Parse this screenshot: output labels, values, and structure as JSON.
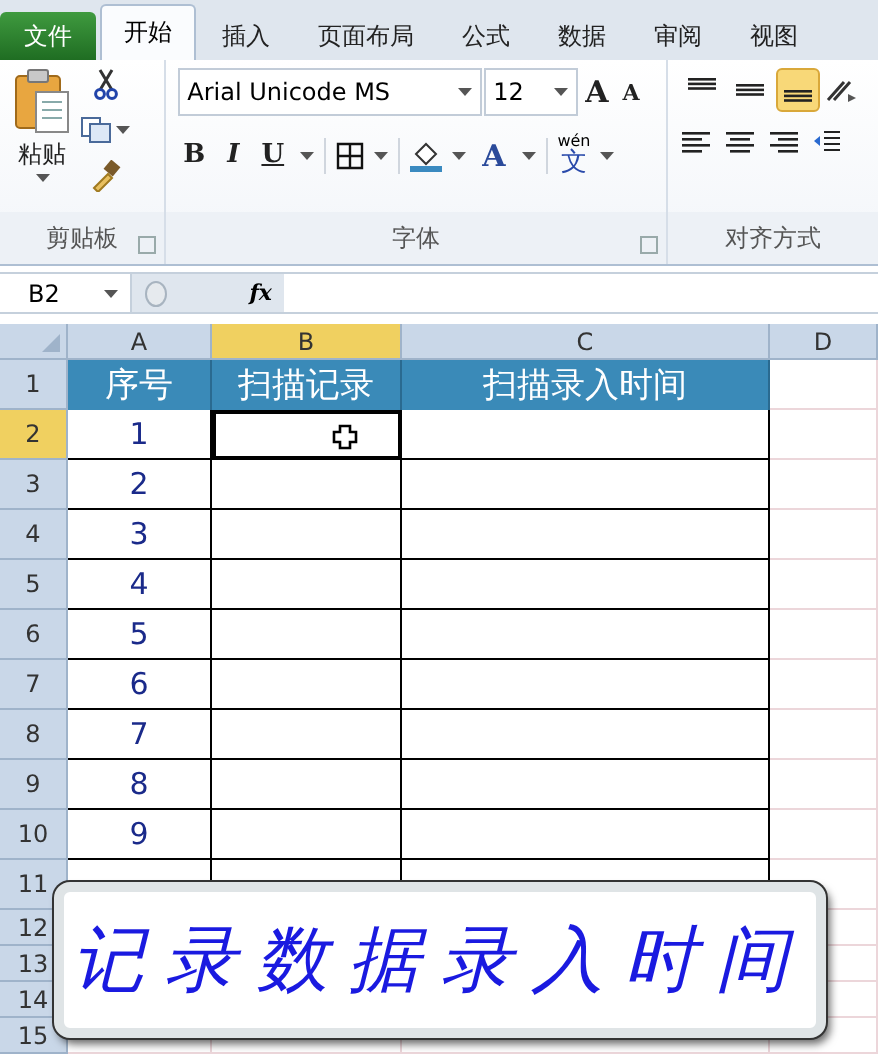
{
  "ribbon_tabs": [
    {
      "label": "文件",
      "kind": "file",
      "selected": false
    },
    {
      "label": "开始",
      "kind": "tab",
      "selected": true
    },
    {
      "label": "插入",
      "kind": "tab",
      "selected": false
    },
    {
      "label": "页面布局",
      "kind": "tab",
      "selected": false
    },
    {
      "label": "公式",
      "kind": "tab",
      "selected": false
    },
    {
      "label": "数据",
      "kind": "tab",
      "selected": false
    },
    {
      "label": "审阅",
      "kind": "tab",
      "selected": false
    },
    {
      "label": "视图",
      "kind": "tab",
      "selected": false
    }
  ],
  "clipboard_group": {
    "paste_label": "粘贴",
    "label": "剪贴板"
  },
  "font_group": {
    "font_name": "Arial Unicode MS",
    "font_size": "12",
    "grow_font": "A",
    "shrink_font": "A",
    "bold": "B",
    "italic": "I",
    "underline": "U",
    "font_color": "A",
    "phonetic_top": "wén",
    "phonetic_main": "文",
    "label": "字体"
  },
  "alignment_group": {
    "top_buttons": [
      {
        "selected": false
      },
      {
        "selected": false
      },
      {
        "selected": true
      }
    ],
    "label": "对齐方式"
  },
  "formula_bar": {
    "name_box": "B2",
    "fx": "fx"
  },
  "sheet": {
    "columns": [
      {
        "label": "A",
        "selected": false
      },
      {
        "label": "B",
        "selected": true
      },
      {
        "label": "C",
        "selected": false
      },
      {
        "label": "D",
        "selected": false
      }
    ],
    "rows": [
      {
        "number": "1",
        "selected": false,
        "cells": [
          "序号",
          "扫描记录",
          "扫描录入时间"
        ]
      },
      {
        "number": "2",
        "selected": true,
        "cells": [
          "1",
          "",
          ""
        ]
      },
      {
        "number": "3",
        "selected": false,
        "cells": [
          "2",
          "",
          ""
        ]
      },
      {
        "number": "4",
        "selected": false,
        "cells": [
          "3",
          "",
          ""
        ]
      },
      {
        "number": "5",
        "selected": false,
        "cells": [
          "4",
          "",
          ""
        ]
      },
      {
        "number": "6",
        "selected": false,
        "cells": [
          "5",
          "",
          ""
        ]
      },
      {
        "number": "7",
        "selected": false,
        "cells": [
          "6",
          "",
          ""
        ]
      },
      {
        "number": "8",
        "selected": false,
        "cells": [
          "7",
          "",
          ""
        ]
      },
      {
        "number": "9",
        "selected": false,
        "cells": [
          "8",
          "",
          ""
        ]
      },
      {
        "number": "10",
        "selected": false,
        "cells": [
          "9",
          "",
          ""
        ]
      },
      {
        "number": "11",
        "selected": false,
        "cells": [
          "",
          "",
          ""
        ]
      },
      {
        "number": "12",
        "selected": false,
        "cells": [
          "",
          "",
          ""
        ]
      },
      {
        "number": "13",
        "selected": false,
        "cells": [
          "",
          "",
          ""
        ]
      },
      {
        "number": "14",
        "selected": false,
        "cells": [
          "",
          "",
          ""
        ]
      },
      {
        "number": "15",
        "selected": false,
        "cells": [
          "",
          "",
          ""
        ]
      }
    ]
  },
  "caption": "记录数据录入时间"
}
